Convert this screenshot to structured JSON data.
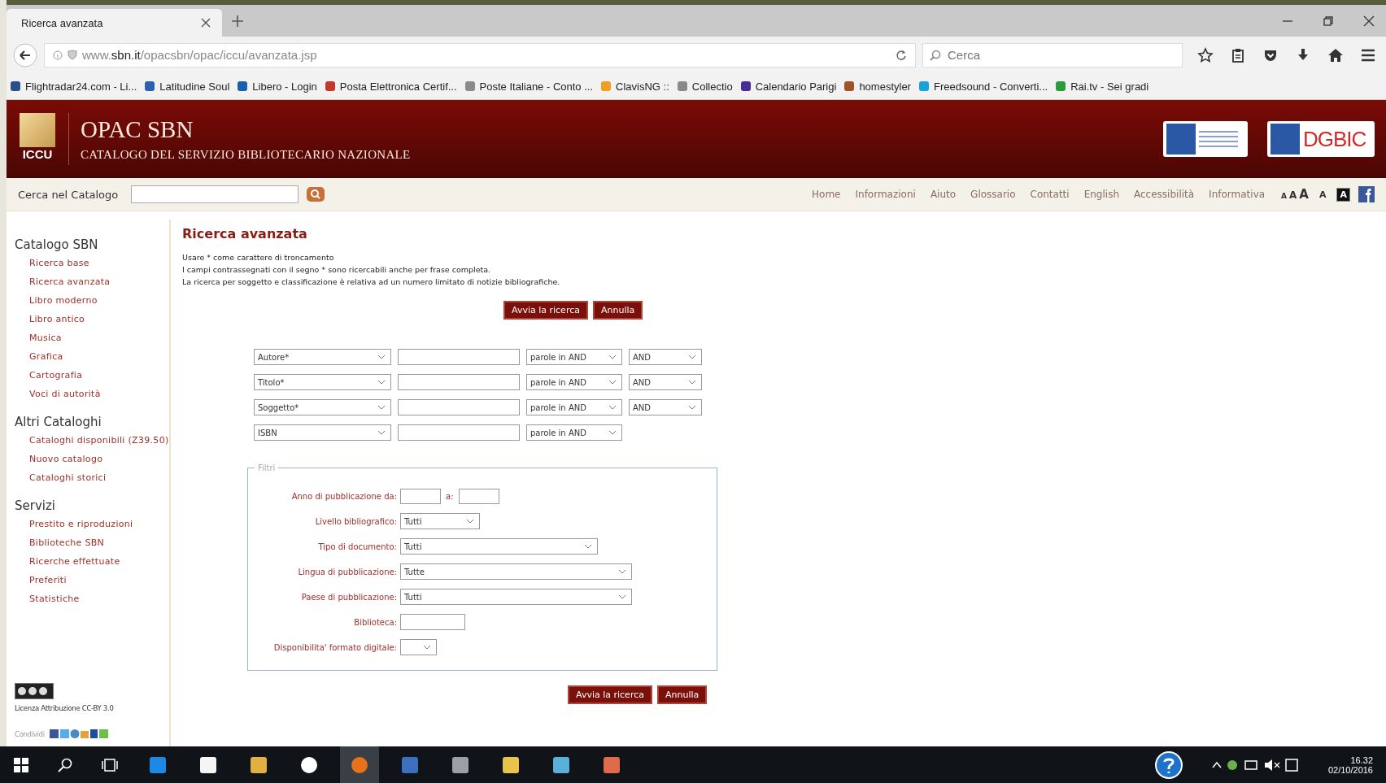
{
  "browser": {
    "tab_title": "Ricerca avanzata",
    "url": "www.**sbn.it**/opacsbn/opac/iccu/avanzata.jsp",
    "search_placeholder": "Cerca",
    "bookmarks": [
      {
        "label": "Flightradar24.com - Li...",
        "color": "#2a4f8a"
      },
      {
        "label": "Latitudine Soul",
        "color": "#2f5fb0"
      },
      {
        "label": "Libero - Login",
        "color": "#1b5fa8"
      },
      {
        "label": "Posta Elettronica Certif...",
        "color": "#c0392b"
      },
      {
        "label": "Poste Italiane - Conto ...",
        "color": "#8a8a8a"
      },
      {
        "label": "ClavisNG ::",
        "color": "#f0a020"
      },
      {
        "label": "Collectio",
        "color": "#8a8a8a"
      },
      {
        "label": "Calendario Parigi",
        "color": "#4a2b9a"
      },
      {
        "label": "homestyler",
        "color": "#a0522d"
      },
      {
        "label": "Freedsound - Converti...",
        "color": "#1aa3d8"
      },
      {
        "label": "Rai.tv - Sei gradi",
        "color": "#2e9b3a"
      }
    ]
  },
  "header": {
    "logo_text": "ICCU",
    "title": "OPAC SBN",
    "subtitle": "CATALOGO DEL SERVIZIO BIBLIOTECARIO NAZIONALE",
    "partner_logo_text": "DGBIC"
  },
  "toolbar": {
    "search_label": "Cerca nel Catalogo",
    "nav_links": [
      "Home",
      "Informazioni",
      "Aiuto",
      "Glossario",
      "Contatti",
      "English",
      "Accessibilità",
      "Informativa"
    ],
    "text_size_buttons": [
      "A",
      "A",
      "A"
    ],
    "contrast_buttons": [
      {
        "label": "A",
        "kind": "normal"
      },
      {
        "label": "A",
        "kind": "inverted"
      }
    ]
  },
  "sidebar": {
    "sections": [
      {
        "title": "Catalogo SBN",
        "items": [
          "Ricerca base",
          "Ricerca avanzata",
          "Libro moderno",
          "Libro antico",
          "Musica",
          "Grafica",
          "Cartografia",
          "Voci di autorità"
        ]
      },
      {
        "title": "Altri Cataloghi",
        "items": [
          "Cataloghi disponibili (Z39.50)",
          "Nuovo catalogo",
          "Cataloghi storici"
        ]
      },
      {
        "title": "Servizi",
        "items": [
          "Prestito e riproduzioni",
          "Biblioteche SBN",
          "Ricerche effettuate",
          "Preferiti",
          "Statistiche"
        ]
      }
    ],
    "license": "Licenza Attribuzione CC-BY 3.0",
    "share_label": "Condividi"
  },
  "main": {
    "title": "Ricerca avanzata",
    "notes": [
      "Usare * come carattere di troncamento",
      "I campi contrassegnati con il segno * sono ricercabili anche per frase completa.",
      "La ricerca per soggetto e classificazione è relativa ad un numero limitato di notizie bibliografiche."
    ],
    "buttons": [
      "Avvia la ricerca",
      "Annulla"
    ],
    "search_rows": [
      {
        "field": "Autore*",
        "mode": "parole in AND",
        "operator": "AND"
      },
      {
        "field": "Titolo*",
        "mode": "parole in AND",
        "operator": "AND"
      },
      {
        "field": "Soggetto*",
        "mode": "parole in AND",
        "operator": "AND"
      },
      {
        "field": "ISBN",
        "mode": "parole in AND"
      }
    ],
    "filters": {
      "legend": "Filtri",
      "rows": [
        {
          "kind": "range",
          "label": "Anno di pubblicazione da:",
          "to_label": "a:"
        },
        {
          "kind": "select",
          "label": "Livello bibliografico:",
          "value": "Tutti"
        },
        {
          "kind": "select",
          "label": "Tipo di documento:",
          "value": "Tutti"
        },
        {
          "kind": "select",
          "label": "Lingua di pubblicazione:",
          "value": "Tutte"
        },
        {
          "kind": "select",
          "label": "Paese di pubblicazione:",
          "value": "Tutti"
        },
        {
          "kind": "input",
          "label": "Biblioteca:"
        },
        {
          "kind": "select",
          "label": "Disponibilita' formato digitale:"
        }
      ]
    },
    "bottom_buttons": [
      "Avvia la ricerca",
      "Annulla"
    ]
  },
  "taskbar": {
    "time": "16.32",
    "date": "02/10/2016"
  }
}
